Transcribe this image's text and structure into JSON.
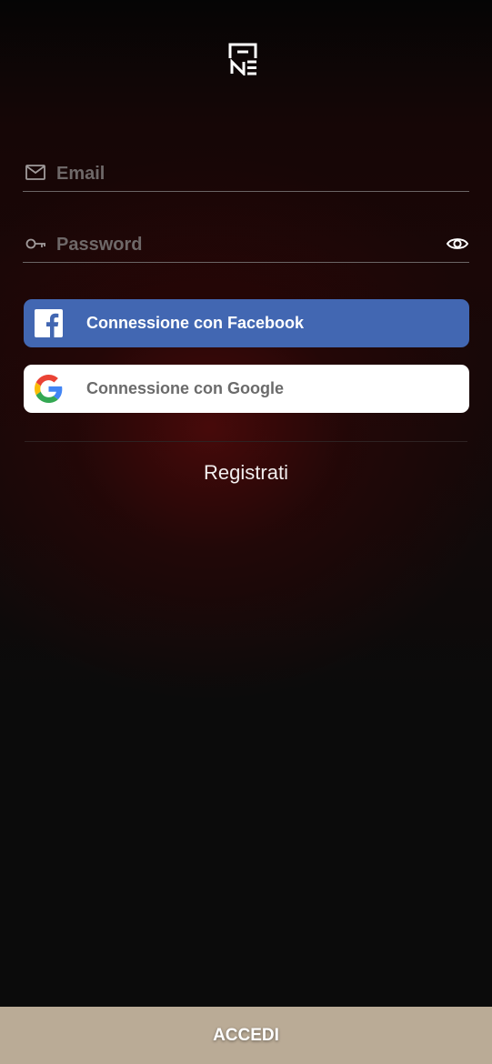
{
  "form": {
    "email_placeholder": "Email",
    "email_value": "",
    "password_placeholder": "Password",
    "password_value": ""
  },
  "buttons": {
    "facebook_label": "Connessione con Facebook",
    "google_label": "Connessione con Google",
    "register_label": "Registrati",
    "login_label": "ACCEDI"
  },
  "icons": {
    "logo": "brand-logo",
    "email": "mail-icon",
    "password": "key-icon",
    "toggle_password": "eye-icon",
    "facebook": "facebook-icon",
    "google": "google-icon"
  },
  "colors": {
    "background": "#0b0b0b",
    "facebook": "#4267b2",
    "google_button": "#ffffff",
    "login_bar": "#baab96",
    "field_underline": "#6a6464"
  }
}
